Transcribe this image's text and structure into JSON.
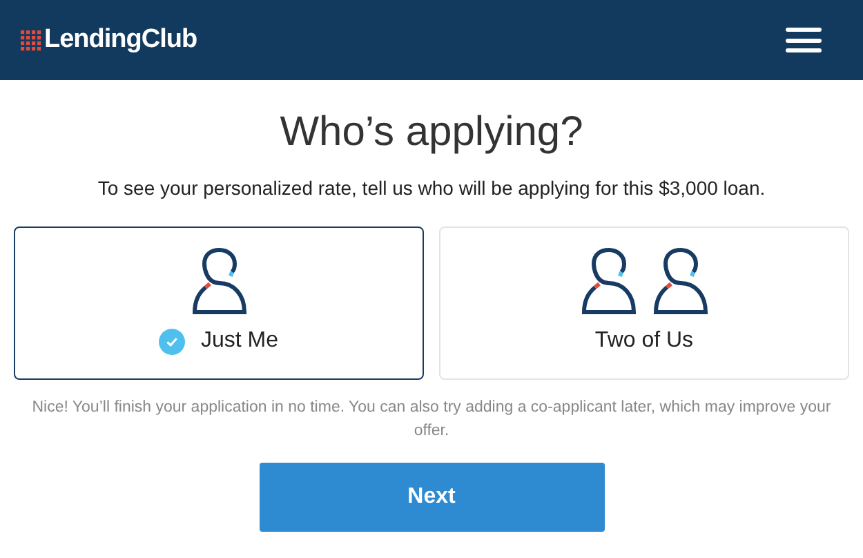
{
  "header": {
    "logo": "LendingClub"
  },
  "title": "Who’s applying?",
  "subtitle": "To see your personalized rate, tell us who will be applying for this $3,000 loan.",
  "options": [
    {
      "kind": "single",
      "label": "Just Me",
      "selected": true
    },
    {
      "kind": "double",
      "label": "Two of Us",
      "selected": false
    }
  ],
  "note": "Nice! You’ll finish your application in no time. You can also try adding a co-applicant later, which may improve your offer.",
  "next_button": "Next"
}
